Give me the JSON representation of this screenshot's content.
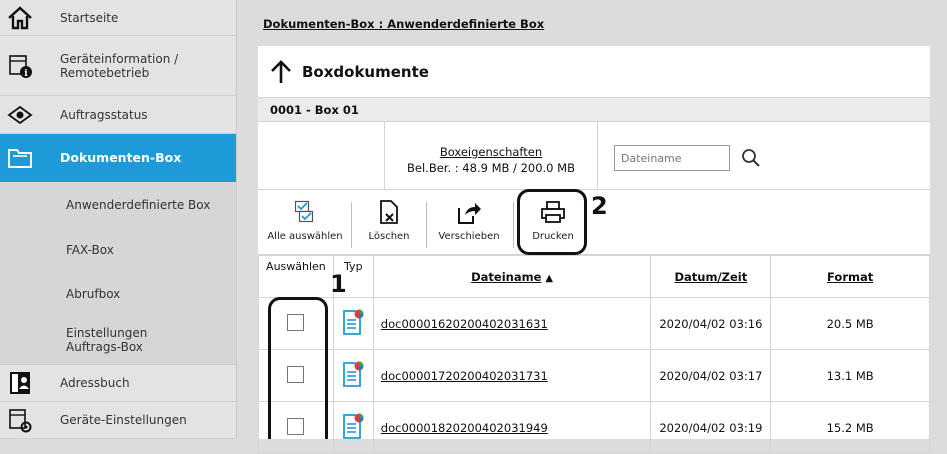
{
  "sidebar": {
    "items": [
      {
        "label": "Startseite",
        "icon": "home-icon"
      },
      {
        "label": "Geräteinformation / Remotebetrieb",
        "icon": "device-info-icon"
      },
      {
        "label": "Auftragsstatus",
        "icon": "eye-icon"
      },
      {
        "label": "Dokumenten-Box",
        "icon": "folder-icon"
      },
      {
        "label": "Anwenderdefinierte Box"
      },
      {
        "label": "FAX-Box"
      },
      {
        "label": "Abrufbox"
      },
      {
        "label": "Einstellungen Auftrags-Box"
      },
      {
        "label": "Adressbuch",
        "icon": "address-book-icon"
      },
      {
        "label": "Geräte-Einstellungen",
        "icon": "device-settings-icon"
      }
    ],
    "active_color": "#1e9ad8"
  },
  "breadcrumb": "Dokumenten-Box : Anwenderdefinierte Box",
  "panel": {
    "title": "Boxdokumente",
    "box_name": "0001 - Box 01",
    "properties_link": "Boxeigenschaften",
    "usage": "Bel.Ber. : 48.9 MB / 200.0 MB",
    "search_placeholder": "Dateiname"
  },
  "toolbar": {
    "select_all": "Alle auswählen",
    "delete": "Löschen",
    "move": "Verschieben",
    "print": "Drucken"
  },
  "table": {
    "headers": {
      "select": "Auswählen",
      "type": "Typ",
      "filename": "Dateiname",
      "datetime": "Datum/Zeit",
      "format": "Format"
    },
    "rows": [
      {
        "name": "doc00001620200402031631",
        "date": "2020/04/02 03:16",
        "size": "20.5 MB"
      },
      {
        "name": "doc00001720200402031731",
        "date": "2020/04/02 03:17",
        "size": "13.1 MB"
      },
      {
        "name": "doc00001820200402031949",
        "date": "2020/04/02 03:19",
        "size": "15.2 MB"
      }
    ]
  },
  "annotations": {
    "callout_1": "1",
    "callout_2": "2"
  }
}
